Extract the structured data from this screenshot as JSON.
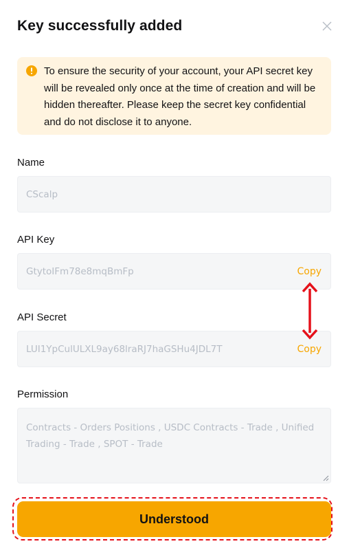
{
  "dialog": {
    "title": "Key successfully added",
    "notice": "To ensure the security of your account, your API secret key will be revealed only once at the time of creation and will be hidden thereafter. Please keep the secret key confidential and do not disclose it to anyone."
  },
  "fields": {
    "name": {
      "label": "Name",
      "value": "CScalp"
    },
    "api_key": {
      "label": "API Key",
      "value": "GtytoIFm78e8mqBmFp",
      "copy_label": "Copy"
    },
    "api_secret": {
      "label": "API Secret",
      "value": "LUI1YpCulULXL9ay68lraRJ7haGSHu4JDL7T",
      "copy_label": "Copy"
    },
    "permission": {
      "label": "Permission",
      "value": "Contracts - Orders Positions  , USDC Contracts - Trade  , Unified Trading - Trade  , SPOT - Trade"
    }
  },
  "actions": {
    "confirm_label": "Understood"
  },
  "icons": {
    "close": "close-icon",
    "warning": "warning-icon",
    "annotation": "double-arrow-icon"
  },
  "colors": {
    "accent": "#f7a600",
    "notice_bg": "#fff4e0",
    "annotation": "#e5111a"
  }
}
